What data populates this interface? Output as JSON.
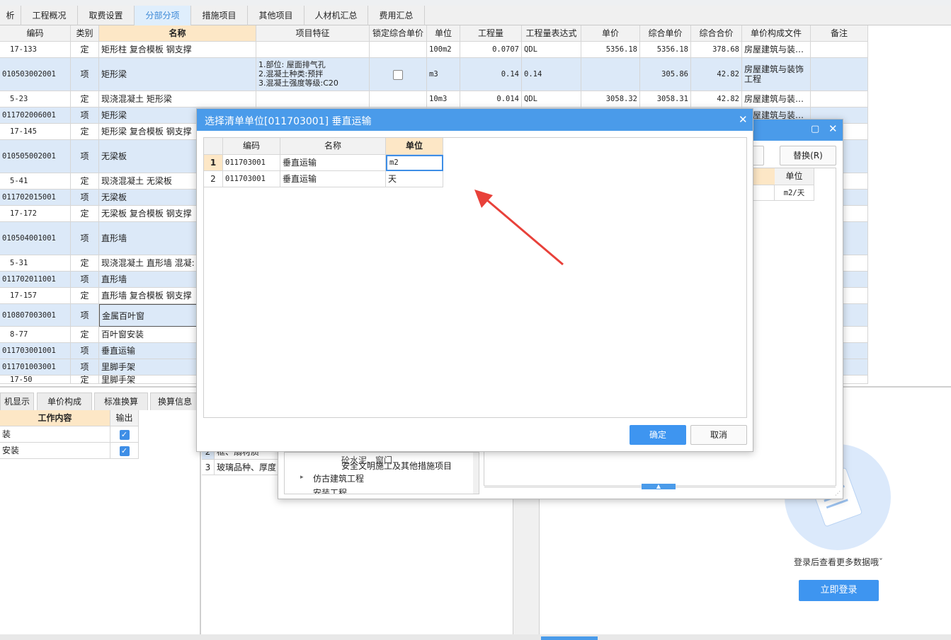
{
  "tabs": [
    "析",
    "工程概况",
    "取费设置",
    "分部分项",
    "措施项目",
    "其他项目",
    "人材机汇总",
    "费用汇总"
  ],
  "main_table": {
    "headers": [
      "编码",
      "类别",
      "名称",
      "项目特征",
      "锁定综合单价",
      "单位",
      "工程量",
      "工程量表达式",
      "单价",
      "综合单价",
      "综合合价",
      "单价构成文件",
      "备注"
    ],
    "rows": [
      {
        "code": "17-133",
        "type": "定",
        "name": "矩形柱 复合模板 钢支撑",
        "feature": "",
        "unit": "100m2",
        "qty": "0.0707",
        "expr": "QDL",
        "price": "5356.18",
        "comp_price": "5356.18",
        "comp_total": "378.68",
        "file": "房屋建筑与装…"
      },
      {
        "code": "010503002001",
        "type": "项",
        "name": "矩形梁",
        "feature_lines": [
          "1.部位: 屋面排气孔",
          "2.混凝土种类:预拌",
          "3.混凝土强度等级:C20"
        ],
        "unit": "m3",
        "qty": "0.14",
        "expr": "0.14",
        "price": "",
        "comp_price": "305.86",
        "comp_total": "42.82",
        "file_lines": [
          "房屋建筑与装饰",
          "工程"
        ]
      },
      {
        "code": "5-23",
        "type": "定",
        "name": "现浇混凝土 矩形梁",
        "feature": "",
        "unit": "10m3",
        "qty": "0.014",
        "expr": "QDL",
        "price": "3058.32",
        "comp_price": "3058.31",
        "comp_total": "42.82",
        "file": "房屋建筑与装…"
      },
      {
        "code": "011702006001",
        "type": "项",
        "name": "矩形梁",
        "file": "房屋建筑与装…"
      },
      {
        "code": "17-145",
        "type": "定",
        "name": "矩形梁 复合模板 钢支撑"
      },
      {
        "code": "010505002001",
        "type": "项",
        "name": "无梁板"
      },
      {
        "code": "5-41",
        "type": "定",
        "name": "现浇混凝土 无梁板"
      },
      {
        "code": "011702015001",
        "type": "项",
        "name": "无梁板"
      },
      {
        "code": "17-172",
        "type": "定",
        "name": "无梁板 复合模板 钢支撑"
      },
      {
        "code": "010504001001",
        "type": "项",
        "name": "直形墙"
      },
      {
        "code": "5-31",
        "type": "定",
        "name": "现浇混凝土 直形墙 混凝:"
      },
      {
        "code": "011702011001",
        "type": "项",
        "name": "直形墙"
      },
      {
        "code": "17-157",
        "type": "定",
        "name": "直形墙 复合模板 钢支撑"
      },
      {
        "code": "010807003001",
        "type": "项",
        "name": "金属百叶窗"
      },
      {
        "code": "8-77",
        "type": "定",
        "name": "百叶窗安装"
      },
      {
        "code": "011703001001",
        "type": "项",
        "name": "垂直运输"
      },
      {
        "code": "011701003001",
        "type": "项",
        "name": "里脚手架"
      },
      {
        "code": "17-50",
        "type": "定",
        "name": "里脚手架"
      }
    ]
  },
  "bottom_tabs": [
    "机显示",
    "单价构成",
    "标准换算",
    "换算信息"
  ],
  "work_table": {
    "headers": [
      "工作内容",
      "输出"
    ],
    "rows": [
      {
        "label": "装",
        "checked": true
      },
      {
        "label": "安装",
        "checked": true
      }
    ]
  },
  "middle_table": {
    "rows": [
      {
        "num": "2",
        "text": "框、扇材质"
      },
      {
        "num": "3",
        "text": "玻璃品种、厚度"
      }
    ]
  },
  "tree": {
    "items": [
      "砼水泥、窗门",
      "安全文明施工及其他措施项目",
      "仿古建筑工程",
      "安装工程"
    ]
  },
  "back_dialog": {
    "replace_button": "替换(R)",
    "left_button": ")",
    "unit_header": "单位",
    "unit_value": "m2/天"
  },
  "ad": {
    "text": "登录后查看更多数据哦ˇ",
    "button": "立即登录"
  },
  "modal": {
    "title": "选择清单单位[011703001] 垂直运输",
    "headers": [
      "编码",
      "名称",
      "单位"
    ],
    "rows": [
      {
        "num": "1",
        "code": "011703001",
        "name": "垂直运输",
        "unit": "m2"
      },
      {
        "num": "2",
        "code": "011703001",
        "name": "垂直运输",
        "unit": "天"
      }
    ],
    "ok": "确定",
    "cancel": "取消"
  },
  "colors": {
    "accent": "#3e95f0",
    "title_bar": "#4a9bea",
    "selected_row": "#dce9f8",
    "header_highlight": "#fde7c6",
    "arrow": "#e8413a"
  }
}
